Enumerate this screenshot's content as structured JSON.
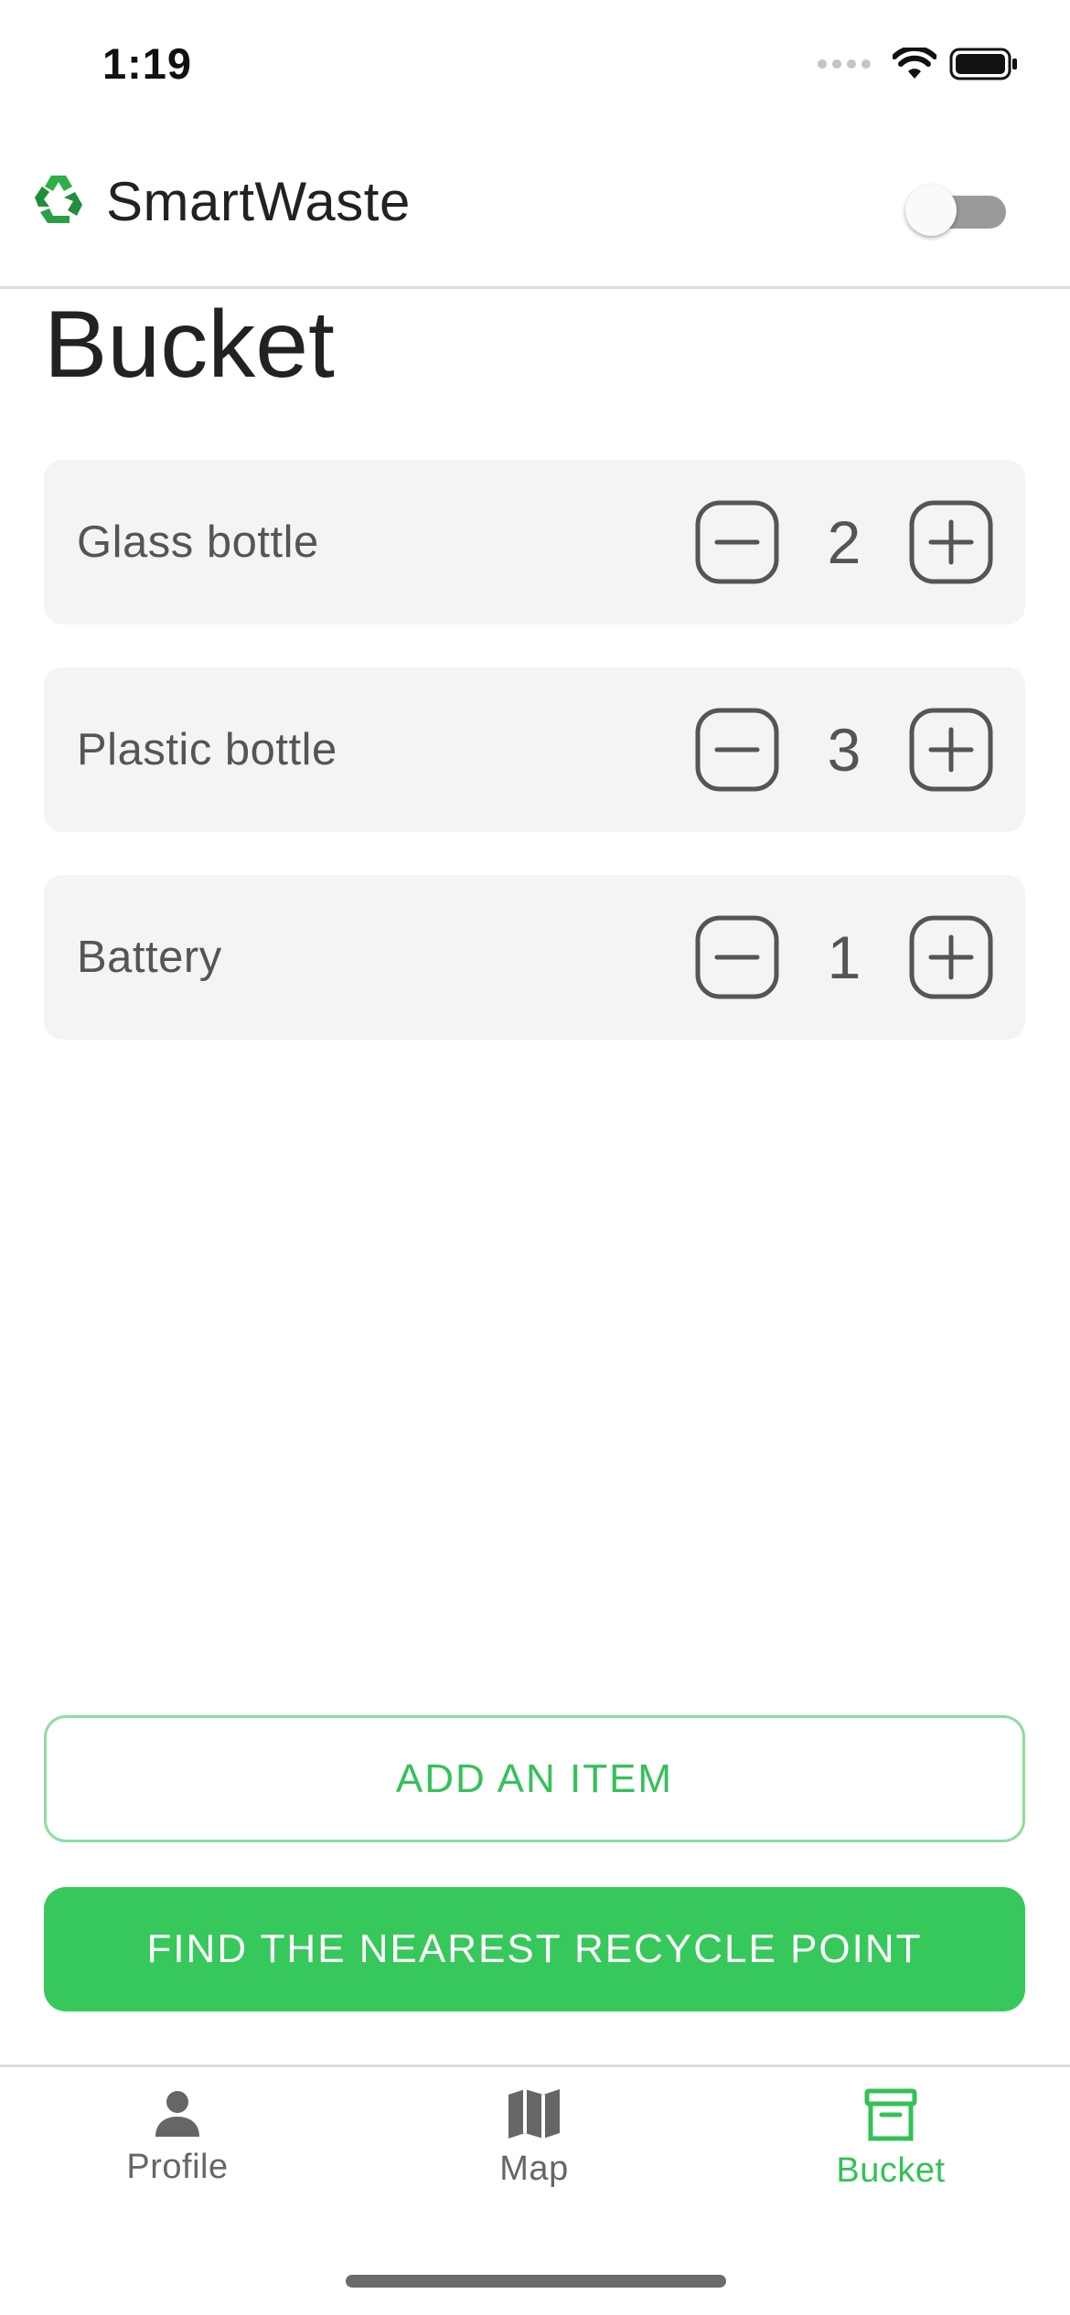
{
  "status_bar": {
    "time": "1:19"
  },
  "header": {
    "app_title": "SmartWaste",
    "dark_mode_toggle": "off"
  },
  "page": {
    "title": "Bucket"
  },
  "items": [
    {
      "name": "Glass bottle",
      "quantity": "2"
    },
    {
      "name": "Plastic bottle",
      "quantity": "3"
    },
    {
      "name": "Battery",
      "quantity": "1"
    }
  ],
  "actions": {
    "add_item": "ADD AN ITEM",
    "find_recycle_point": "FIND THE NEAREST RECYCLE POINT"
  },
  "bottom_nav": {
    "items": [
      {
        "label": "Profile",
        "icon": "person-icon",
        "active": false
      },
      {
        "label": "Map",
        "icon": "map-icon",
        "active": false
      },
      {
        "label": "Bucket",
        "icon": "archive-box-icon",
        "active": true
      }
    ]
  },
  "colors": {
    "accent_green": "#37c85b",
    "outline_green": "#8fdca0",
    "card_background": "#f4f4f4",
    "toggle_track": "#9a9a9a"
  }
}
